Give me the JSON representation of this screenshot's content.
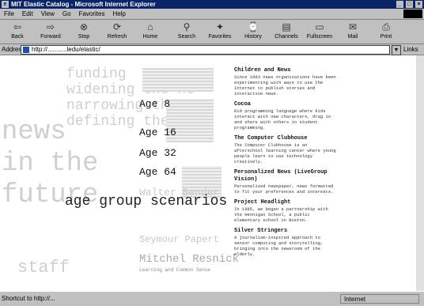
{
  "window": {
    "title": "MIT Elastic Catalog - Microsoft Internet Explorer",
    "buttons": [
      "_",
      "□",
      "×"
    ]
  },
  "menu": [
    "File",
    "Edit",
    "View",
    "Go",
    "Favorites",
    "Help"
  ],
  "toolbar": [
    {
      "label": "Back",
      "icon": "back-arrow-icon",
      "glyph": "⇦"
    },
    {
      "label": "Forward",
      "icon": "forward-arrow-icon",
      "glyph": "⇨"
    },
    {
      "label": "Stop",
      "icon": "stop-icon",
      "glyph": "⊗"
    },
    {
      "label": "Refresh",
      "icon": "refresh-icon",
      "glyph": "⟳"
    },
    {
      "label": "Home",
      "icon": "home-icon",
      "glyph": "⌂"
    },
    {
      "label": "Search",
      "icon": "search-icon",
      "glyph": "⚲"
    },
    {
      "label": "Favorites",
      "icon": "favorites-icon",
      "glyph": "✦"
    },
    {
      "label": "History",
      "icon": "history-icon",
      "glyph": "⌚"
    },
    {
      "label": "Channels",
      "icon": "channels-icon",
      "glyph": "▤"
    },
    {
      "label": "Fullscreen",
      "icon": "fullscreen-icon",
      "glyph": "▭"
    },
    {
      "label": "Mail",
      "icon": "mail-icon",
      "glyph": "✉"
    },
    {
      "label": "Print",
      "icon": "print-icon",
      "glyph": "⎙"
    }
  ],
  "address": {
    "label": "Address",
    "value": "http://...........ledu/elastic/",
    "links_label": "Links"
  },
  "background": {
    "funding_line1": "funding",
    "funding_line2": "widening the ne",
    "funding_line3": "narrowing the g",
    "funding_line4": "defining the cat",
    "news": "news",
    "in_the": "in the",
    "future": "future",
    "staff": "staff"
  },
  "ages": [
    "Age 8",
    "Age 16",
    "Age 32",
    "Age 64"
  ],
  "scenarios_label": "age group scenarios",
  "people": [
    {
      "name": "Walter Bender"
    },
    {
      "name": "Seymour Papert"
    },
    {
      "name": "Mitchel Resnick",
      "note": "Learning and Common Sense"
    }
  ],
  "projects": [
    {
      "title": "Children and News",
      "desc": "Since 1993 news organizations have been experimenting with ways to use the Internet to publish stories and interactive news."
    },
    {
      "title": "Cocoa",
      "desc": "Kid programming language where kids interact with new characters, drag in and share with others in student programming."
    },
    {
      "title": "The Computer Clubhouse",
      "desc": "The Computer Clubhouse is an afterschool learning center where young people learn to use technology creatively."
    },
    {
      "title": "Personalized News (LiveGroup Vision)",
      "desc": "Personalized newspaper, news formatted to fit your preferences and interests."
    },
    {
      "title": "Project Headlight",
      "desc": "In 1985, we began a partnership with the Hennigan School, a public elementary school in Boston."
    },
    {
      "title": "Silver Stringers",
      "desc": "A journalism-inspired approach to senior computing and storytelling, bringing into the newsroom of the elderly."
    }
  ],
  "status": {
    "text": "Shortcut to http://...",
    "zone": "Internet"
  }
}
